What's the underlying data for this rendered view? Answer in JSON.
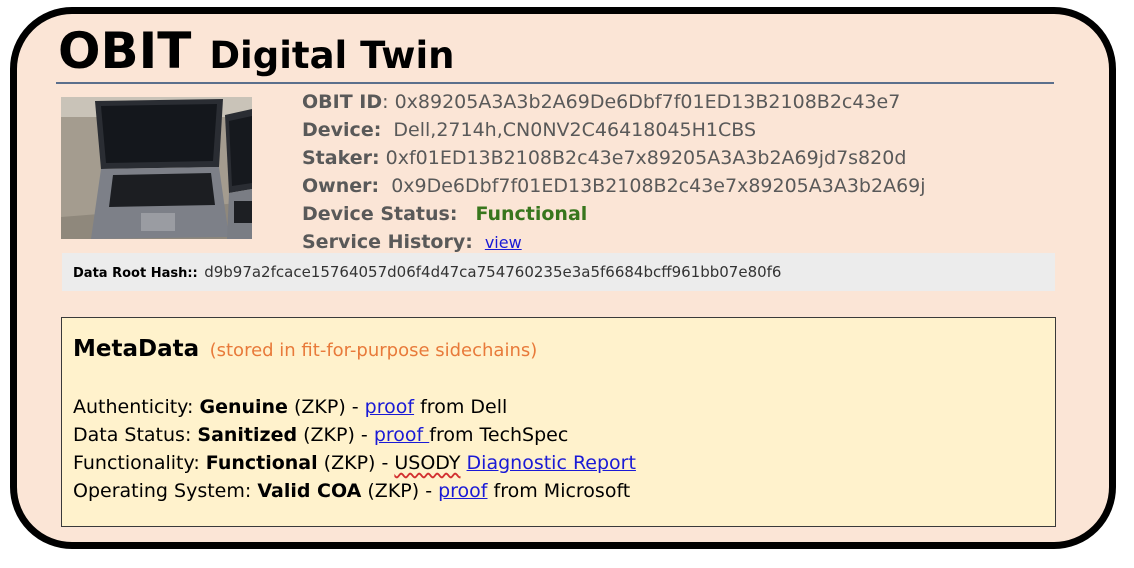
{
  "title": {
    "main": "OBIT",
    "sub": "Digital Twin"
  },
  "info": {
    "obit_id_label": "OBIT ID",
    "obit_id_value": ": 0x89205A3A3b2A69De6Dbf7f01ED13B2108B2c43e7",
    "device_label": "Device:",
    "device_value": "Dell,2714h,CN0NV2C46418045H1CBS",
    "staker_label": "Staker:",
    "staker_value": "0xf01ED13B2108B2c43e7x89205A3A3b2A69jd7s820d",
    "owner_label": "Owner:",
    "owner_value": "0x9De6Dbf7f01ED13B2108B2c43e7x89205A3A3b2A69j",
    "status_label": "Device Status:",
    "status_value": "Functional",
    "history_label": "Service History:",
    "history_link": "view"
  },
  "hash": {
    "label": "Data Root Hash::",
    "value": "d9b97a2fcace15764057d06f4d47ca754760235e3a5f6684bcff961bb07e80f6"
  },
  "metadata": {
    "title": "MetaData",
    "subtitle": "(stored in fit-for-purpose sidechains)",
    "lines": [
      {
        "prefix": "Authenticity: ",
        "bold": "Genuine",
        "mid": " (ZKP) - ",
        "link": "proof",
        "suffix": " from Dell"
      },
      {
        "prefix": "Data Status: ",
        "bold": "Sanitized",
        "mid": " (ZKP) - ",
        "link": "proof ",
        "suffix": "from TechSpec"
      },
      {
        "prefix": "Functionality: ",
        "bold": "Functional",
        "mid": " (ZKP) - ",
        "plain": "USODY",
        "link": "Diagnostic Report",
        "suffix": ""
      },
      {
        "prefix": "Operating System: ",
        "bold": "Valid COA",
        "mid": " (ZKP) - ",
        "link": "proof",
        "suffix": " from Microsoft"
      }
    ]
  },
  "colors": {
    "card_bg": "#fbe5d6",
    "status_green": "#38761d",
    "link_blue": "#1a1ad6",
    "subtitle_orange": "#e87a3a",
    "metadata_bg": "#fff2cc",
    "hash_bg": "#ececec"
  }
}
